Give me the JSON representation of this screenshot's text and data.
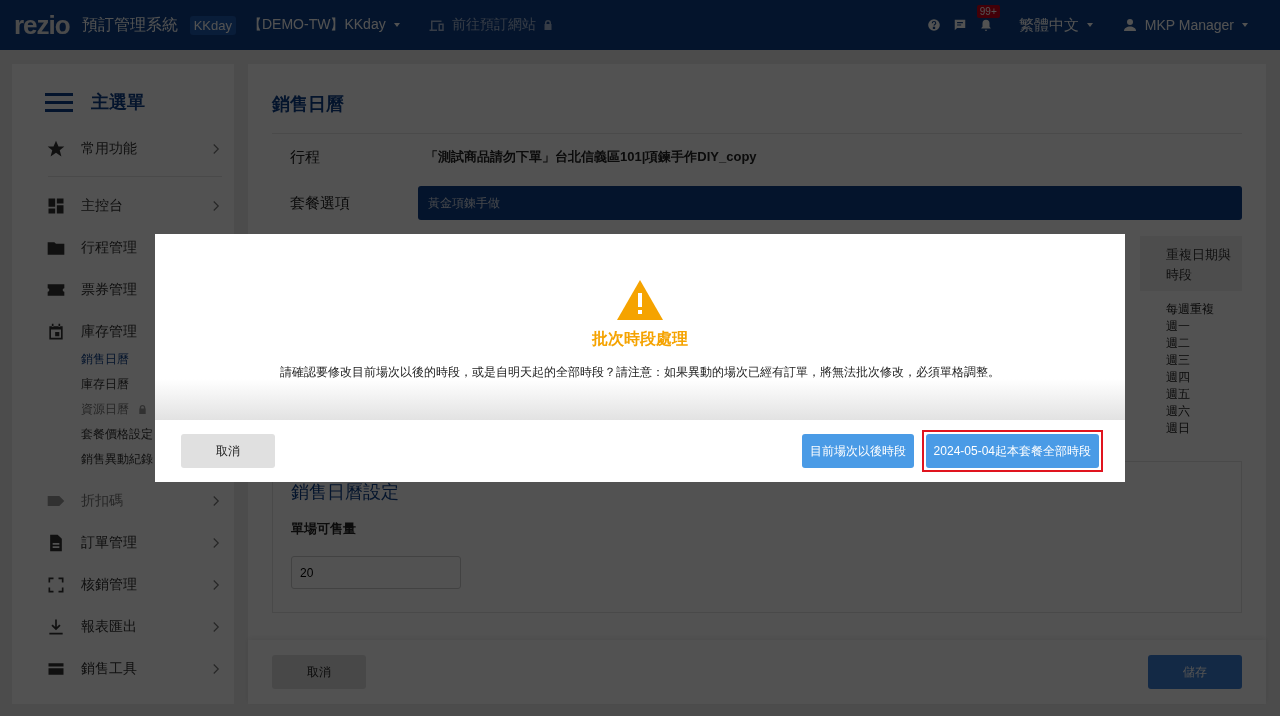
{
  "header": {
    "logo": "rezio",
    "system_name": "預訂管理系統",
    "account_badge": "KKday",
    "account_name": "【DEMO-TW】KKday",
    "booking_site": {
      "label": "前往預訂網站",
      "disabled": true
    },
    "notification_count": "99+",
    "language": "繁體中文",
    "user": "MKP Manager"
  },
  "sidebar": {
    "title": "主選單",
    "items": [
      {
        "label": "常用功能",
        "disabled": false
      },
      {
        "label": "主控台",
        "disabled": false
      },
      {
        "label": "行程管理",
        "disabled": false
      },
      {
        "label": "票券管理",
        "disabled": false
      },
      {
        "label": "庫存管理",
        "disabled": false,
        "children": [
          {
            "label": "銷售日曆",
            "selected": true,
            "locked": false
          },
          {
            "label": "庫存日曆",
            "selected": false,
            "locked": false
          },
          {
            "label": "資源日曆",
            "selected": false,
            "locked": true
          },
          {
            "label": "套餐價格設定",
            "selected": false,
            "locked": false
          },
          {
            "label": "銷售異動紀錄",
            "selected": false,
            "locked": false
          }
        ]
      },
      {
        "label": "折扣碼",
        "disabled": true
      },
      {
        "label": "訂單管理",
        "disabled": false
      },
      {
        "label": "核銷管理",
        "disabled": false
      },
      {
        "label": "報表匯出",
        "disabled": false
      },
      {
        "label": "銷售工具",
        "disabled": false
      }
    ]
  },
  "page": {
    "title": "銷售日曆",
    "fields": [
      {
        "label": "行程",
        "kind": "text",
        "value": "「測試商品請勿下單」台北信義區101|項鍊手作DIY_copy"
      },
      {
        "label": "套餐選項",
        "kind": "select",
        "value": "黃金項鍊手做"
      }
    ],
    "repeat_column": {
      "header": "重複日期與時段",
      "lines": [
        "每週重複",
        "週一",
        "週二",
        "週三",
        "週四",
        "週五",
        "週六",
        "週日"
      ]
    },
    "settings": {
      "title": "銷售日曆設定",
      "field_label": "單場可售量",
      "field_value": "20"
    },
    "footer_buttons": [
      {
        "label": "取消",
        "kind": "secondary"
      },
      {
        "label": "儲存",
        "kind": "primary"
      }
    ]
  },
  "dialog": {
    "title": "批次時段處理",
    "message": "請確認要修改目前場次以後的時段，或是自明天起的全部時段？請注意：如果異動的場次已經有訂單，將無法批次修改，必須單格調整。",
    "buttons": [
      {
        "label": "取消",
        "kind": "secondary",
        "highlighted": false
      },
      {
        "label": "目前場次以後時段",
        "kind": "primary",
        "highlighted": false
      },
      {
        "label": "2024-05-04起本套餐全部時段",
        "kind": "primary",
        "highlighted": true
      }
    ]
  }
}
